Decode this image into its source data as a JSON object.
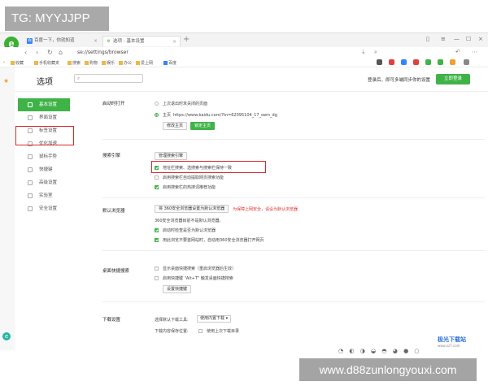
{
  "overlay_badge": "TG: MYYJJPP",
  "tabs": [
    {
      "label": "百度一下，你就知道"
    },
    {
      "label": "选项 - 基本设置"
    }
  ],
  "address": {
    "url": "se://settings/browser"
  },
  "bookmarks": [
    "收藏",
    "手机收藏夹",
    "搜索",
    "购物",
    "娱乐",
    "办公",
    "爱上网",
    "百度"
  ],
  "options": {
    "title": "选项",
    "login_tip": "登录后，即可多端同步你的设置",
    "login_button": "立即登录"
  },
  "sidebar": {
    "items": [
      {
        "label": "基本设置",
        "active": true
      },
      {
        "label": "界面设置"
      },
      {
        "label": "标签设置"
      },
      {
        "label": "优化加速"
      },
      {
        "label": "鼠标手势"
      },
      {
        "label": "快捷键"
      },
      {
        "label": "高级设置"
      },
      {
        "label": "实验室"
      },
      {
        "label": "安全设置"
      }
    ]
  },
  "startup": {
    "label": "启动时打开",
    "opt_restore": "上次退出时未关闭的页面",
    "opt_home": "主页",
    "home_url": "https://www.baidu.com/?tn=62095104_17_oem_dg",
    "btn_modify": "修改主页",
    "btn_lock": "锁定主页"
  },
  "search": {
    "label": "搜索引擎",
    "btn_manage": "管理搜索引擎",
    "opt_sync": "地址栏搜索、选搜索与搜索栏保持一致",
    "opt_auto": "启用搜索栏自动提取网页搜索功能",
    "opt_hot": "启用搜索栏的热搜词推荐功能"
  },
  "default_browser": {
    "label": "默认浏览器",
    "btn_set": "将 360安全浏览器设置为默认浏览器",
    "protect_text": "为保障上网安全，请设为默认浏览器",
    "status": "360安全浏览器目前不是默认浏览器。",
    "opt_check": "启动时检查是否为默认浏览器",
    "opt_links": "用此浏览不要首网站时，自动用360安全浏览器打开网页"
  },
  "desktop_search": {
    "label": "桌面快捷搜索",
    "opt_show": "显示桌面快捷搜索（重启浏览器后生效）",
    "opt_hotkey": "启用快捷键 \"Alt+T\" 触发桌面快捷搜索",
    "btn_set": "设置快捷键"
  },
  "download": {
    "label": "下载设置",
    "tool_label": "选择默认下载工具:",
    "tool_value": "使用内置下载",
    "path_label": "下载内容保存位置:",
    "path_value": "使用上次下载目录"
  },
  "watermark": {
    "name": "极光下载站",
    "site": "www.xz7.com"
  },
  "footer_url": "www.d88zunlongyouxi.com",
  "colors": {
    "accent": "#3fb347",
    "highlight": "#d9262c"
  }
}
